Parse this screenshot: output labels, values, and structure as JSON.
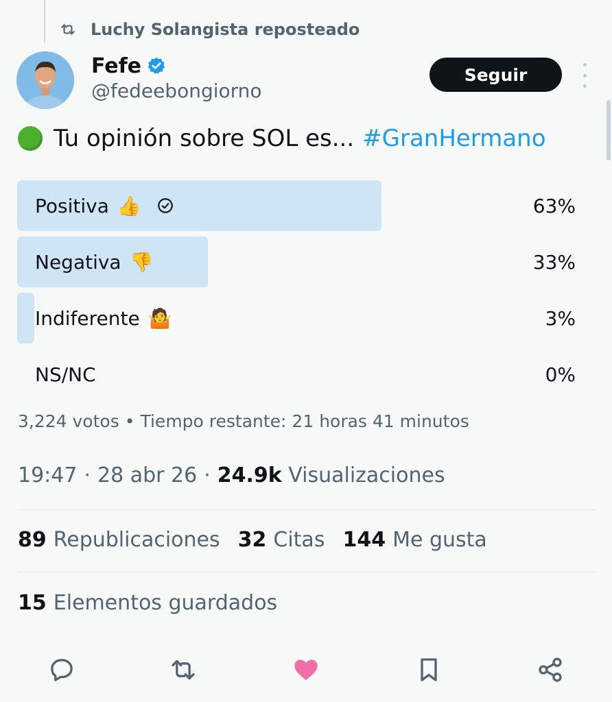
{
  "repost": {
    "text": "Luchy Solangista reposteado",
    "icon": "repost-icon"
  },
  "author": {
    "name": "Fefe",
    "handle": "@fedeebongiorno",
    "verified_icon": "verified-badge-icon"
  },
  "follow_button": "Seguir",
  "tweet": {
    "emoji": "green-circle",
    "text": "Tu opinión sobre SOL es...",
    "hashtag": "#GranHermano"
  },
  "poll": {
    "options": [
      {
        "label": "Positiva",
        "emoji": "👍",
        "percent": "63%",
        "fill": 0.63,
        "winner": true
      },
      {
        "label": "Negativa",
        "emoji": "👎",
        "percent": "33%",
        "fill": 0.33,
        "winner": false
      },
      {
        "label": "Indiferente",
        "emoji": "🤷",
        "percent": "3%",
        "fill": 0.03,
        "winner": false
      },
      {
        "label": "NS/NC",
        "emoji": "",
        "percent": "0%",
        "fill": 0.0,
        "winner": false
      }
    ],
    "votes": "3,224 votos",
    "separator": "•",
    "time_left": "Tiempo restante: 21 horas 41 minutos"
  },
  "meta": {
    "time": "19:47",
    "date": "28 abr 26",
    "dot": "·",
    "views_count": "24.9k",
    "views_label": "Visualizaciones"
  },
  "stats": {
    "reposts_count": "89",
    "reposts_label": "Republicaciones",
    "quotes_count": "32",
    "quotes_label": "Citas",
    "likes_count": "144",
    "likes_label": "Me gusta",
    "saved_count": "15",
    "saved_label": "Elementos guardados"
  },
  "colors": {
    "accent": "#1d9bf0",
    "poll_bar": "#cfe4f5",
    "like": "#f06fa8",
    "muted": "#536471"
  },
  "actions": [
    "reply-icon",
    "repost-icon",
    "like-icon",
    "bookmark-icon",
    "share-icon"
  ]
}
